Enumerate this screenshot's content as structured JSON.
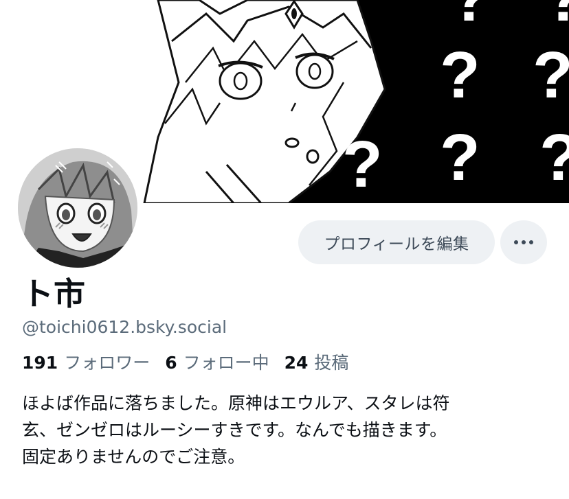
{
  "profile": {
    "display_name": "ト市",
    "handle": "@toichi0612.bsky.social",
    "bio": "ほよば作品に落ちました。原神はエウルア、スタレは符\n玄、ゼンゼロはルーシーすきです。なんでも描きます。\n固定ありませんのでご注意。"
  },
  "actions": {
    "edit_profile_label": "プロフィールを編集",
    "more_icon": "ellipsis-icon"
  },
  "stats": {
    "followers_count": "191",
    "followers_label": "フォロワー",
    "following_count": "6",
    "following_label": "フォロー中",
    "posts_count": "24",
    "posts_label": "投稿"
  },
  "banner": {
    "question_mark": "?"
  },
  "colors": {
    "text_primary": "#0b0f14",
    "text_secondary": "#5b6b7a",
    "button_bg": "#eef1f4",
    "button_text": "#3d4a58",
    "banner_panel": "#000000"
  }
}
